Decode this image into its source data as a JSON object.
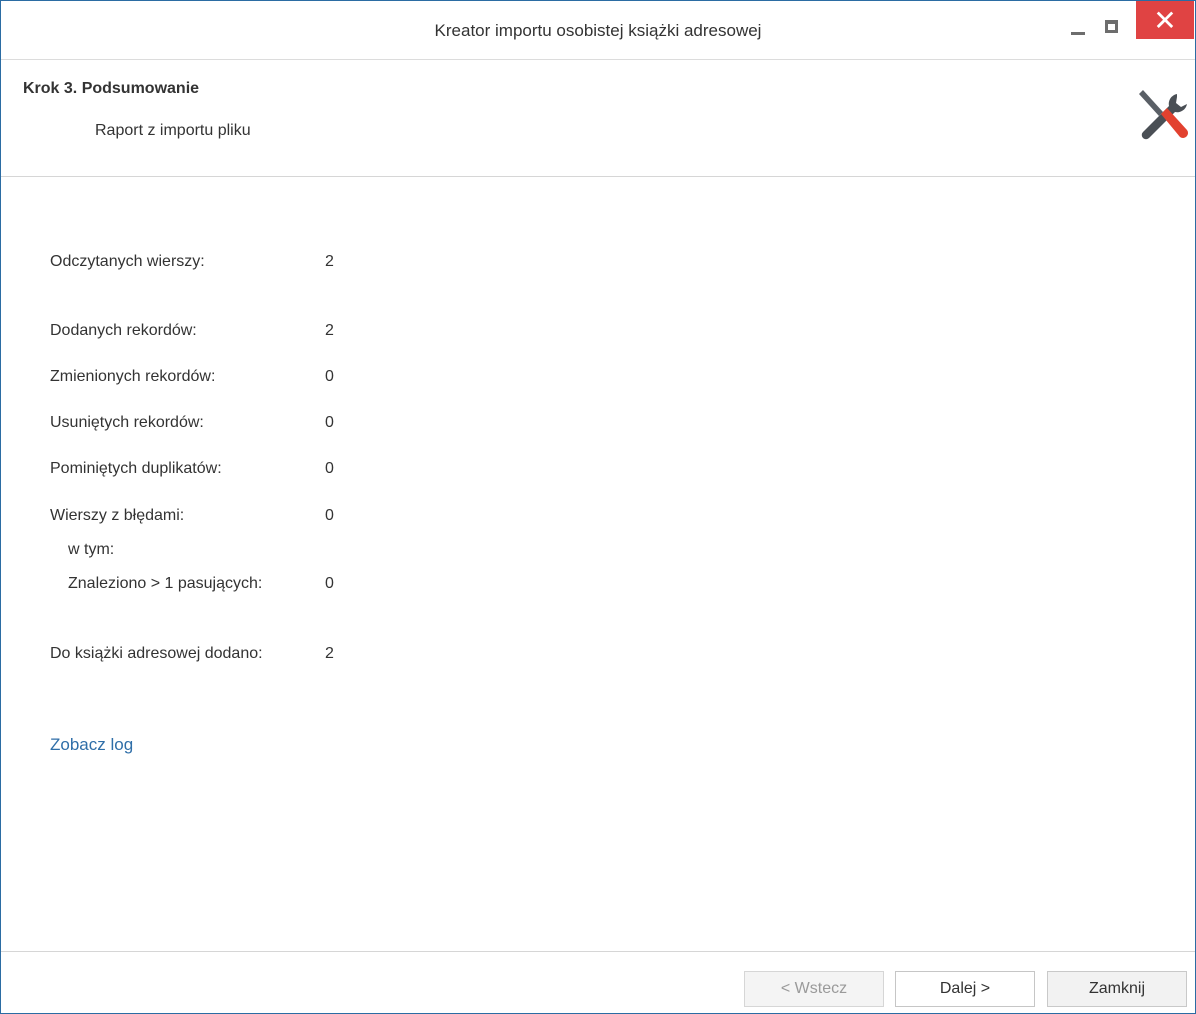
{
  "window": {
    "title": "Kreator importu osobistej książki adresowej",
    "close_glyph": "✕"
  },
  "header": {
    "step_title": "Krok 3. Podsumowanie",
    "step_subtitle": "Raport z importu pliku",
    "icon": "tools-icon"
  },
  "summary": [
    {
      "label": "Odczytanych wierszy:",
      "value": "2"
    },
    {
      "label": "Dodanych rekordów:",
      "value": "2"
    },
    {
      "label": "Zmienionych rekordów:",
      "value": "0"
    },
    {
      "label": "Usuniętych rekordów:",
      "value": "0"
    },
    {
      "label": "Pominiętych duplikatów:",
      "value": "0"
    },
    {
      "label": "Wierszy z błędami:",
      "value": "0"
    },
    {
      "label": "w tym:",
      "value": ""
    },
    {
      "label": "Znaleziono > 1 pasujących:",
      "value": "0"
    },
    {
      "label": "Do książki adresowej dodano:",
      "value": "2"
    }
  ],
  "log_link": "Zobacz log",
  "footer": {
    "back_label": "< Wstecz",
    "next_label": "Dalej >",
    "close_label": "Zamknij"
  },
  "colors": {
    "accent_blue": "#2f6ea8",
    "close_red": "#e04343",
    "window_border": "#2b6ca3"
  }
}
